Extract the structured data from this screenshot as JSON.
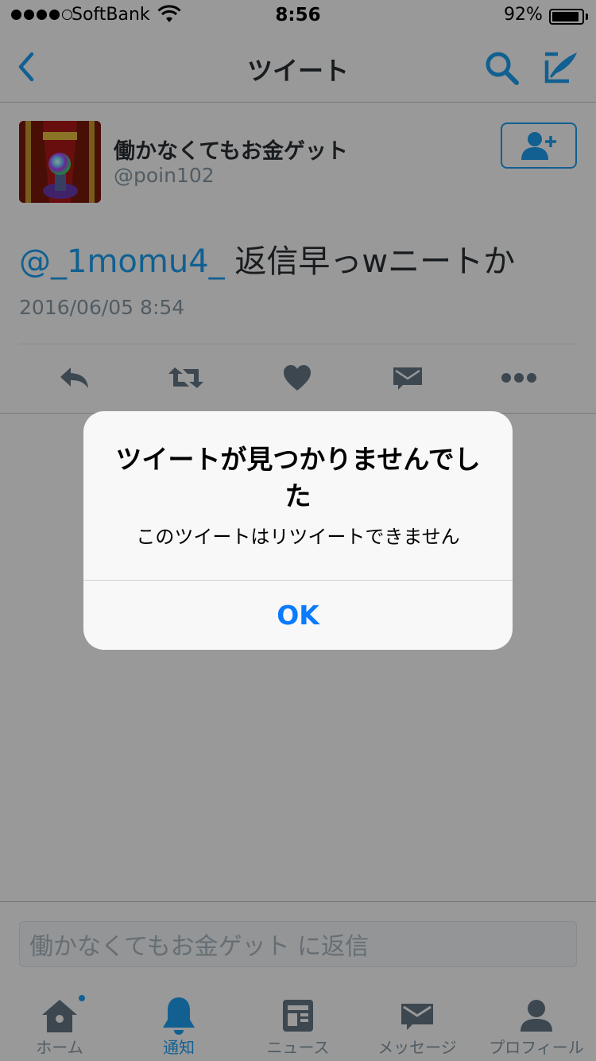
{
  "status_bar": {
    "carrier": "SoftBank",
    "time": "8:56",
    "battery_percent": "92%",
    "battery_level": 0.92
  },
  "nav": {
    "title": "ツイート"
  },
  "tweet": {
    "author_name": "働かなくてもお金ゲット",
    "author_handle": "@poin102",
    "mention": "@_1momu4_",
    "body": " 返信早っwニートか",
    "timestamp": "2016/06/05 8:54"
  },
  "reply": {
    "placeholder": "働かなくてもお金ゲット に返信"
  },
  "tabs": [
    {
      "label": "ホーム",
      "icon": "home-icon"
    },
    {
      "label": "通知",
      "icon": "bell-icon"
    },
    {
      "label": "ニュース",
      "icon": "news-icon"
    },
    {
      "label": "メッセージ",
      "icon": "envelope-icon"
    },
    {
      "label": "プロフィール",
      "icon": "person-icon"
    }
  ],
  "alert": {
    "title": "ツイートが見つかりませんでした",
    "message": "このツイートはリツイートできません",
    "ok_label": "OK"
  },
  "colors": {
    "accent": "#1da1f2",
    "ios_blue": "#0a7aff",
    "muted": "#8899a6",
    "icon_gray": "#657786"
  }
}
